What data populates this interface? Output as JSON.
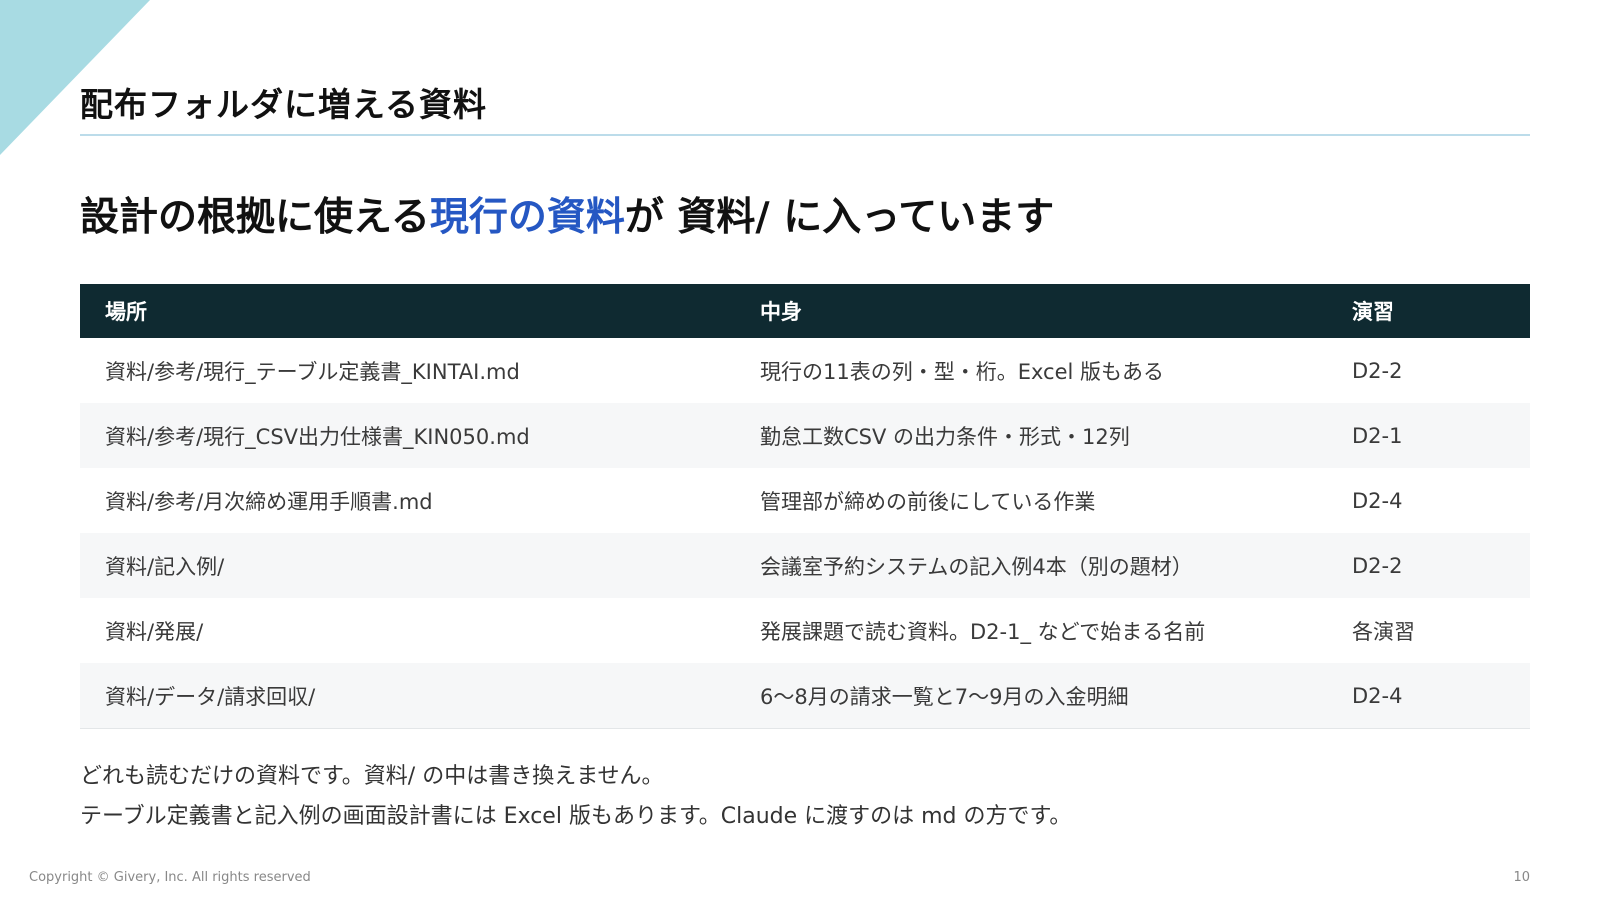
{
  "title": "配布フォルダに増える資料",
  "headline": {
    "before": "設計の根拠に使える",
    "highlight": "現行の資料",
    "after": "が 資料/ に入っています"
  },
  "colors": {
    "highlight": "#2557c3",
    "table_header_bg": "#0f2a31",
    "corner_accent": "#a8dbe3"
  },
  "table": {
    "headers": {
      "location": "場所",
      "content": "中身",
      "exercise": "演習"
    },
    "rows": [
      {
        "location": "資料/参考/現行_テーブル定義書_KINTAI.md",
        "content": "現行の11表の列・型・桁。Excel 版もある",
        "exercise": "D2-2"
      },
      {
        "location": "資料/参考/現行_CSV出力仕様書_KIN050.md",
        "content": "勤怠工数CSV の出力条件・形式・12列",
        "exercise": "D2-1"
      },
      {
        "location": "資料/参考/月次締め運用手順書.md",
        "content": "管理部が締めの前後にしている作業",
        "exercise": "D2-4"
      },
      {
        "location": "資料/記入例/",
        "content": "会議室予約システムの記入例4本（別の題材）",
        "exercise": "D2-2"
      },
      {
        "location": "資料/発展/",
        "content": "発展課題で読む資料。D2-1_ などで始まる名前",
        "exercise": "各演習"
      },
      {
        "location": "資料/データ/請求回収/",
        "content": "6〜8月の請求一覧と7〜9月の入金明細",
        "exercise": "D2-4"
      }
    ]
  },
  "notes": [
    "どれも読むだけの資料です。資料/ の中は書き換えません。",
    "テーブル定義書と記入例の画面設計書には Excel 版もあります。Claude に渡すのは md の方です。"
  ],
  "footer": {
    "copyright": "Copyright © Givery, Inc. All rights reserved",
    "page": "10"
  }
}
